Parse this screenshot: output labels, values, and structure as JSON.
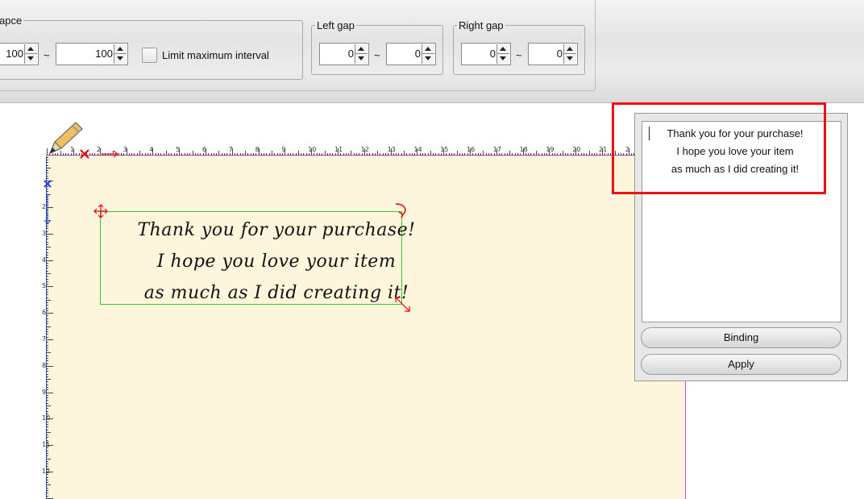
{
  "toolbar": {
    "space_group": {
      "legend": "apce",
      "min": "100",
      "separator": "~",
      "max": "100",
      "limit_label": "Limit maximum interval"
    },
    "left_gap": {
      "legend": "Left gap",
      "min": "0",
      "separator": "~",
      "max": "0"
    },
    "right_gap": {
      "legend": "Right gap",
      "min": "0",
      "separator": "~",
      "max": "0"
    }
  },
  "canvas": {
    "ruler_h": [
      "1",
      "2",
      "3",
      "4",
      "5",
      "6",
      "7",
      "8",
      "9",
      "10",
      "11",
      "12",
      "13",
      "14",
      "15",
      "16",
      "17",
      "18",
      "19",
      "20",
      "21",
      "2"
    ],
    "ruler_v": [
      "2",
      "3",
      "4",
      "5",
      "6",
      "7",
      "8",
      "9",
      "10",
      "11",
      "12"
    ],
    "handwriting": [
      "Thank you for your purchase!",
      "I hope you love your item",
      "as much as I did creating it!"
    ]
  },
  "panel": {
    "text_lines": [
      "Thank you for your purchase!",
      "I hope you love your item",
      "as much as I did creating it!"
    ],
    "binding_label": "Binding",
    "apply_label": "Apply"
  },
  "colors": {
    "paper": "#fdf6dc",
    "selection": "#33cc33",
    "highlight": "#ee1111",
    "ruler_h_line": "#d030d0",
    "ruler_v_line": "#2040e0"
  }
}
